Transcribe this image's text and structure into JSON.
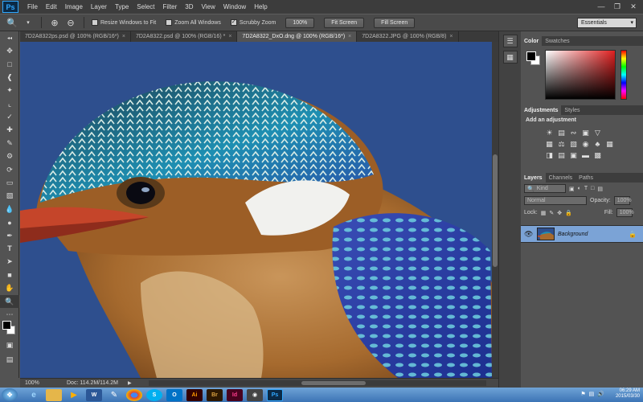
{
  "app": {
    "logo": "Ps"
  },
  "menu": [
    "File",
    "Edit",
    "Image",
    "Layer",
    "Type",
    "Select",
    "Filter",
    "3D",
    "View",
    "Window",
    "Help"
  ],
  "options_bar": {
    "tool_icon": "zoom-icon",
    "checkboxes": [
      {
        "label": "Resize Windows to Fit",
        "checked": false
      },
      {
        "label": "Zoom All Windows",
        "checked": false
      },
      {
        "label": "Scrubby Zoom",
        "checked": true
      }
    ],
    "buttons": [
      "100%",
      "Fit Screen",
      "Fill Screen"
    ],
    "workspace": "Essentials"
  },
  "doc_tabs": [
    {
      "label": "7D2A8322ps.psd @ 100% (RGB/16*)",
      "active": false
    },
    {
      "label": "7D2A8322.psd @ 100% (RGB/16) *",
      "active": false
    },
    {
      "label": "7D2A8322_DxO.dng @ 100% (RGB/16*)",
      "active": true
    },
    {
      "label": "7D2A8322.JPG @ 100% (RGB/8)",
      "active": false
    }
  ],
  "status_bar": {
    "zoom": "100%",
    "doc": "Doc: 114.2M/114.2M"
  },
  "panels": {
    "color_tabs": [
      "Color",
      "Swatches"
    ],
    "adjust_tabs": [
      "Adjustments",
      "Styles"
    ],
    "adjust_title": "Add an adjustment",
    "layer_tabs": [
      "Layers",
      "Channels",
      "Paths"
    ],
    "kind_filter": "Kind",
    "blend_mode": "Normal",
    "opacity_label": "Opacity:",
    "opacity_value": "100%",
    "lock_label": "Lock:",
    "fill_label": "Fill:",
    "fill_value": "100%",
    "layer_name": "Background"
  },
  "taskbar": {
    "apps": [
      "W",
      "O",
      "Ai",
      "Br",
      "Id",
      "Ps"
    ],
    "time": "06:29 AM",
    "date": "2015/03/30"
  }
}
